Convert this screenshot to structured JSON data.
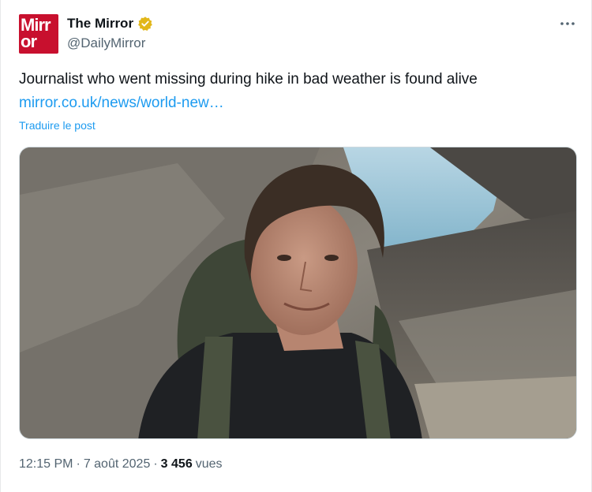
{
  "author": {
    "avatar_text_line1": "Mirr",
    "avatar_text_line2": "or",
    "display_name": "The Mirror",
    "handle": "@DailyMirror",
    "verified": true,
    "verified_color": "#e2b719",
    "avatar_color": "#c8102e"
  },
  "tweet": {
    "text": "Journalist who went missing during hike in bad weather is found alive",
    "link_text": "mirror.co.uk/news/world-new…",
    "translate_label": "Traduire le post",
    "media_icon": "photo-of-hiker-icon"
  },
  "footer": {
    "time": "12:15 PM",
    "separator": "·",
    "date": "7 août 2025",
    "views_count": "3 456",
    "views_label": "vues"
  },
  "colors": {
    "link": "#1d9bf0",
    "secondary_text": "#536471",
    "primary_text": "#0f1419"
  }
}
